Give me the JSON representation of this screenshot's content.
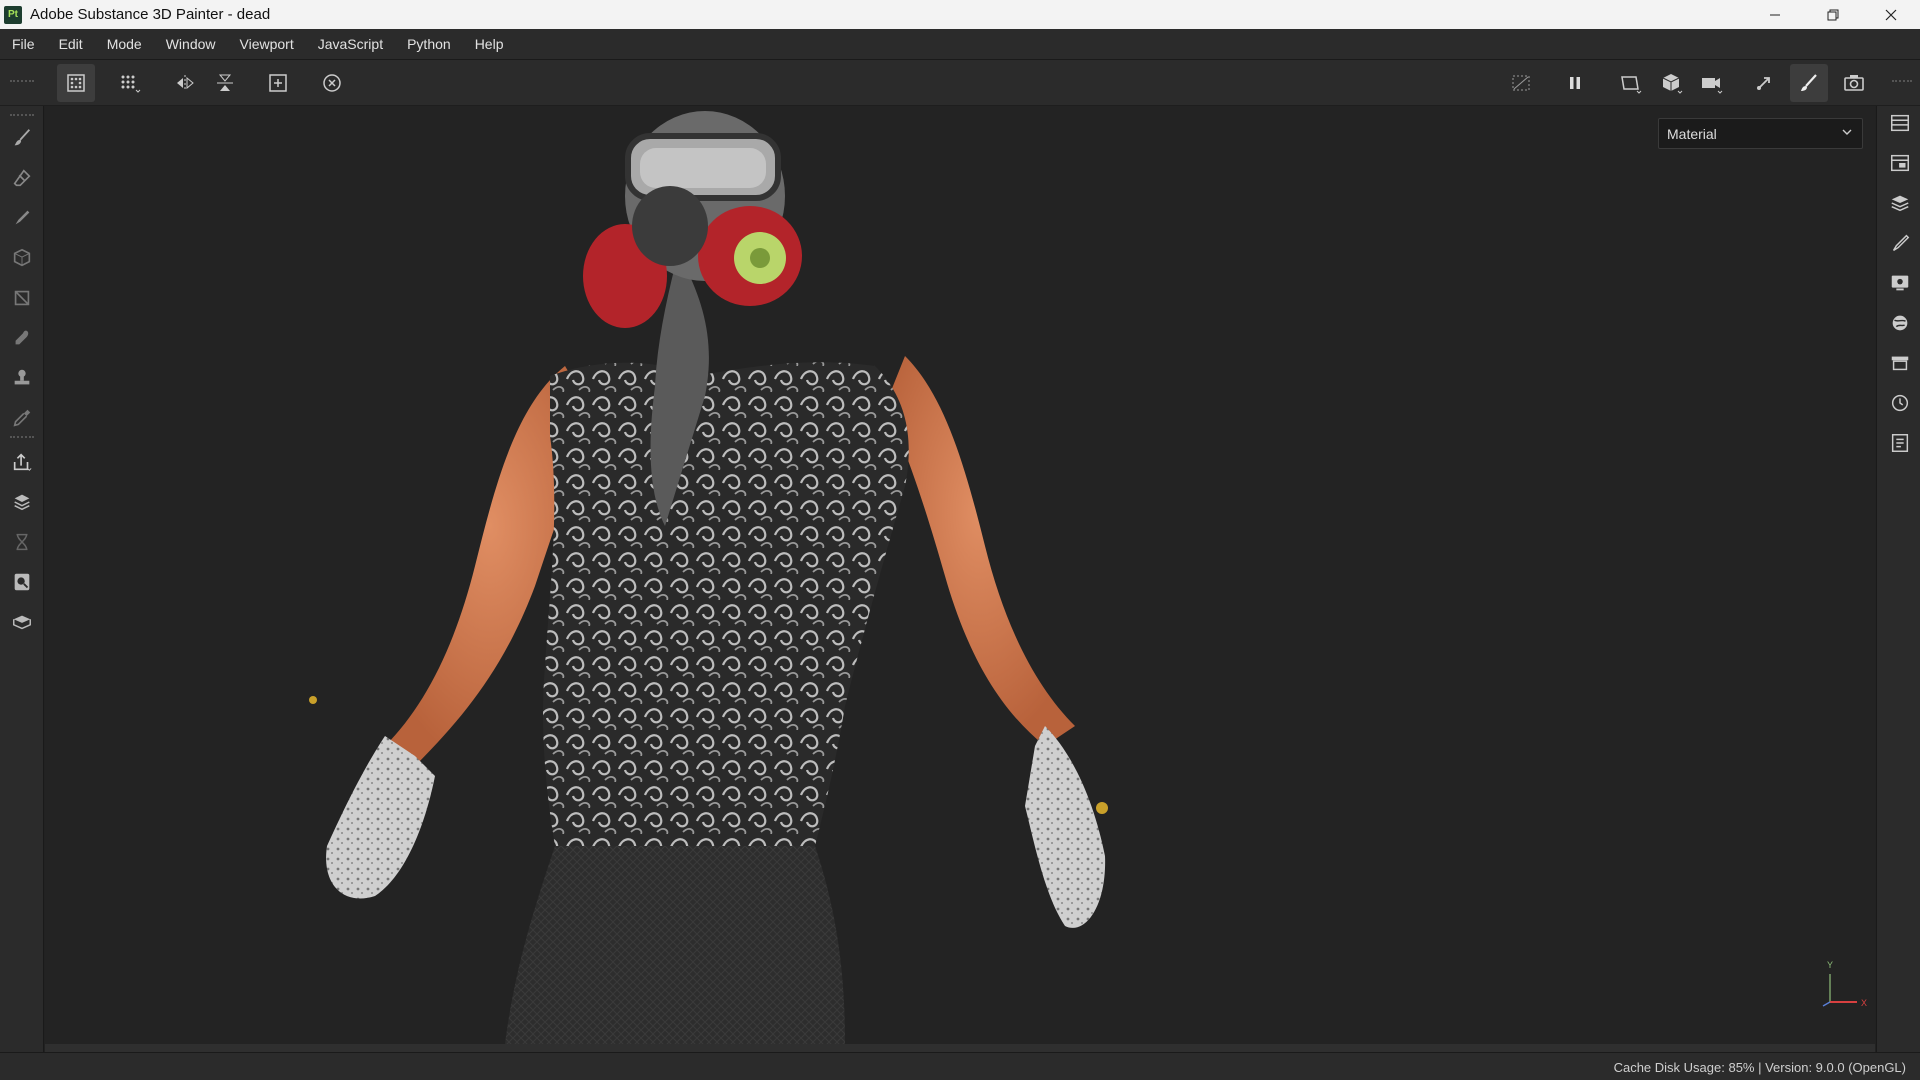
{
  "window": {
    "app_icon_text": "Pt",
    "title": "Adobe Substance 3D Painter - dead"
  },
  "menu": {
    "items": [
      "File",
      "Edit",
      "Mode",
      "Window",
      "Viewport",
      "JavaScript",
      "Python",
      "Help"
    ]
  },
  "toolbar": {
    "left_icons": [
      "texture-set-icon",
      "grid-symmetry-icon",
      "mirror-horizontal-icon",
      "mirror-vertical-icon",
      "add-frame-icon",
      "reset-camera-icon"
    ],
    "right_icons": [
      "hide-ui-icon",
      "pause-icon",
      "viewport-2d-icon",
      "material-cube-icon",
      "camera-icon",
      "arrow-tool-icon",
      "brush-active-icon",
      "screenshot-icon"
    ]
  },
  "left_tools": [
    "paint-brush-icon",
    "eraser-icon",
    "projection-icon",
    "geometry-mask-icon",
    "polygon-fill-icon",
    "smudge-icon",
    "clone-stamp-icon",
    "color-picker-icon",
    "export-icon",
    "bake-icon",
    "hourglass-icon",
    "search-settings-icon",
    "shelf-box-icon"
  ],
  "right_dock": [
    "layers-list-icon",
    "texture-set-list-icon",
    "layers-stack-icon",
    "properties-brush-icon",
    "display-settings-icon",
    "shader-settings-icon",
    "shelf-icon",
    "history-icon",
    "log-icon"
  ],
  "viewport": {
    "mode_value": "Material",
    "axis_y": "Y",
    "axis_x": "X"
  },
  "status": {
    "text": "Cache Disk Usage:   85% | Version: 9.0.0 (OpenGL)"
  },
  "colors": {
    "skin": "#cf7b52",
    "shirt": "#2a2a2a",
    "mask_red": "#b3242a",
    "filter_green": "#b9d56a",
    "glove": "#c9c9c9",
    "pants": "#303030"
  }
}
